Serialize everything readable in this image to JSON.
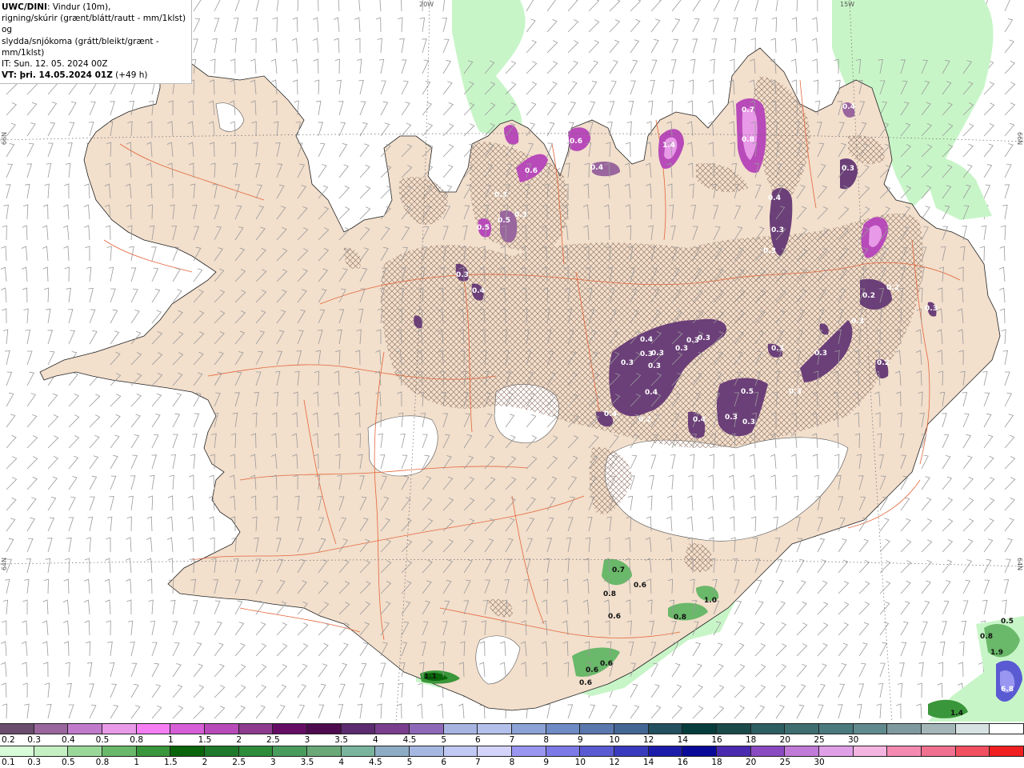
{
  "info": {
    "model": "UWC/DINI",
    "desc1": ": Vindur (10m),",
    "desc2": "rigning/skúrir (grænt/blátt/rautt - mm/1klst) og",
    "desc3": "slydda/snjókoma (grátt/bleikt/grænt - mm/1klst)",
    "it": "IT: Sun. 12. 05. 2024 00Z",
    "vt_label": "VT: þri. 14.05.2024 01Z",
    "vt_extra": " (+49 h)"
  },
  "graticule": {
    "top": [
      "20W",
      "15W"
    ],
    "left_mid": "66N",
    "left_low": "64N",
    "right_mid": "66N",
    "right_low": "64N"
  },
  "colors": {
    "sea": "#ffffff",
    "land": "#f2dfcc",
    "glacier": "#ffffff",
    "roads": "#e4663a",
    "rain_light": "#c8f5c8",
    "snow_purple": "#6b3f78",
    "snow_magenta": "#d060d8"
  },
  "snow_labels": [
    "0.3",
    "0.6",
    "0.4",
    "0.5",
    "0.6",
    "0.4",
    "0.3",
    "1.4",
    "0.7",
    "0.8",
    "0.4",
    "0.3",
    "0.3",
    "0.3",
    "0.5",
    "0.3",
    "0.4",
    "0.4",
    "0.3",
    "0.3",
    "0.3",
    "0.3",
    "0.3",
    "0.3",
    "0.3",
    "0.4",
    "0.3",
    "0.3",
    "0.5",
    "0.4",
    "0.2",
    "0.4",
    "0.3",
    "0.3",
    "0.3",
    "0.2",
    "0.2",
    "0.2",
    "0.3",
    "0.3"
  ],
  "rain_labels": [
    "0.7",
    "0.6",
    "0.8",
    "0.6",
    "1.0",
    "0.8",
    "0.6",
    "0.6",
    "0.6",
    "1.1",
    "0.5",
    "0.8",
    "1.9",
    "6.8",
    "1.4"
  ],
  "snow_scale": {
    "colors": [
      "#6a4c6c",
      "#9a669e",
      "#c07acb",
      "#e89ae8",
      "#f57ef5",
      "#d65ed6",
      "#b84ab9",
      "#8e3a8e",
      "#650c65",
      "#4e0a4e",
      "#5c2a6e",
      "#7a3e8e",
      "#8e68b8",
      "#a7b4e2",
      "#b4c0ec",
      "#8da2d6",
      "#6f8bc6",
      "#5a78ae",
      "#446694",
      "#22505e",
      "#073c3c",
      "#1a4a4a",
      "#2d5e62",
      "#3e6e70",
      "#4a7a7e",
      "#608a8e",
      "#7f9a9e",
      "#a4b6b8",
      "#d6e2e2",
      "#ffffff"
    ],
    "ticks": [
      "0.2",
      "0.3",
      "0.4",
      "0.5",
      "0.8",
      "1",
      "1.5",
      "2",
      "2.5",
      "3",
      "3.5",
      "4",
      "4.5",
      "5",
      "6",
      "7",
      "8",
      "9",
      "10",
      "12",
      "14",
      "16",
      "18",
      "20",
      "25",
      "30"
    ]
  },
  "rain_scale": {
    "colors": [
      "#d8fcd8",
      "#c4f0c4",
      "#9ad89a",
      "#6ab86a",
      "#3a963a",
      "#0a640a",
      "#1e7a2a",
      "#2e8c3a",
      "#4a9c5c",
      "#6aa878",
      "#7ab49e",
      "#8eacc4",
      "#a6b8e2",
      "#c0c8f4",
      "#d4d4fa",
      "#9896f0",
      "#7c7ae6",
      "#5a5ad2",
      "#3a3abe",
      "#1c1caa",
      "#0a0a9a",
      "#4a2aae",
      "#8a4ac2",
      "#c07ad8",
      "#e0a0e8",
      "#f4b4e0",
      "#f48ab0",
      "#f07090",
      "#f05060",
      "#f02020"
    ],
    "ticks": [
      "0.1",
      "0.3",
      "0.5",
      "0.8",
      "1",
      "1.5",
      "2",
      "2.5",
      "3",
      "3.5",
      "4",
      "4.5",
      "5",
      "6",
      "7",
      "8",
      "9",
      "10",
      "12",
      "14",
      "16",
      "18",
      "20",
      "25",
      "30"
    ]
  }
}
